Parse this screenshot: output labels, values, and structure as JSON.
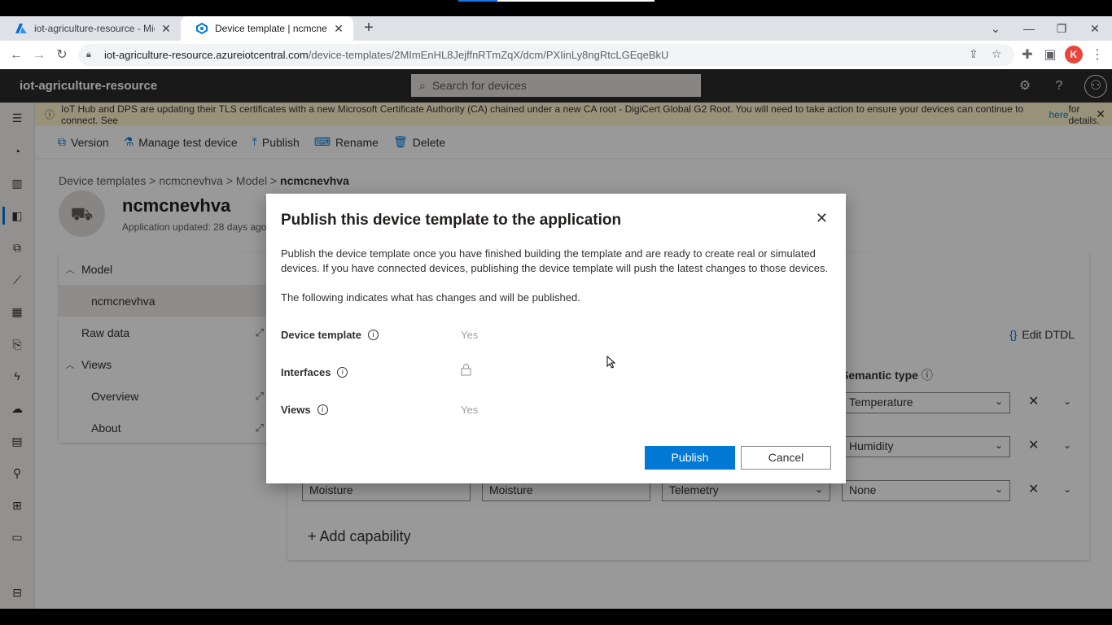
{
  "browser": {
    "tabs": [
      {
        "title": "iot-agriculture-resource - Micros",
        "active": false
      },
      {
        "title": "Device template | ncmcnevhva, ic",
        "active": true
      }
    ],
    "url_host": "iot-agriculture-resource.azureiotcentral.com",
    "url_path": "/device-templates/2MImEnHL8JejffnRTmZqX/dcm/PXIinLy8ngRtcLGEqeBkU",
    "profile_initial": "K"
  },
  "app": {
    "name": "iot-agriculture-resource",
    "search_placeholder": "Search for devices"
  },
  "banner": {
    "text": "IoT Hub and DPS are updating their TLS certificates with a new Microsoft Certificate Authority (CA) chained under a new CA root - DigiCert Global G2 Root. You will need to take action to ensure your devices can continue to connect. See ",
    "link": "here",
    "suffix": " for details."
  },
  "commands": [
    "Version",
    "Manage test device",
    "Publish",
    "Rename",
    "Delete"
  ],
  "breadcrumb": {
    "c1": "Device templates",
    "c2": "ncmcnevhva",
    "c3": "Model",
    "c4": "ncmcnevhva",
    "sep": ">"
  },
  "device": {
    "name": "ncmcnevhva",
    "updated": "Application updated: 28 days ago"
  },
  "tree": {
    "model": "Model",
    "model_child": "ncmcnevhva",
    "raw": "Raw data",
    "views": "Views",
    "overview": "Overview",
    "about": "About"
  },
  "panel": {
    "edit_dtdl": "Edit DTDL",
    "semantic_header": "Semantic type",
    "rows": [
      {
        "semantic": "Temperature"
      },
      {
        "semantic": "Humidity"
      },
      {
        "display": "Moisture",
        "name": "Moisture",
        "type": "Telemetry",
        "semantic": "None"
      }
    ],
    "add_capability": "Add capability"
  },
  "dialog": {
    "title": "Publish this device template to the application",
    "para1": "Publish the device template once you have finished building the template and are ready to create real or simulated devices. If you have connected devices, publishing the device template will push the latest changes to those devices.",
    "para2": "The following indicates what has changes and will be published.",
    "items": [
      {
        "label": "Device template",
        "value": "Yes"
      },
      {
        "label": "Interfaces",
        "value": ""
      },
      {
        "label": "Views",
        "value": "Yes"
      }
    ],
    "publish_label": "Publish",
    "cancel_label": "Cancel"
  },
  "colors": {
    "accent": "#0078d4",
    "header": "#2b2b2b",
    "banner": "#fff4ce"
  }
}
